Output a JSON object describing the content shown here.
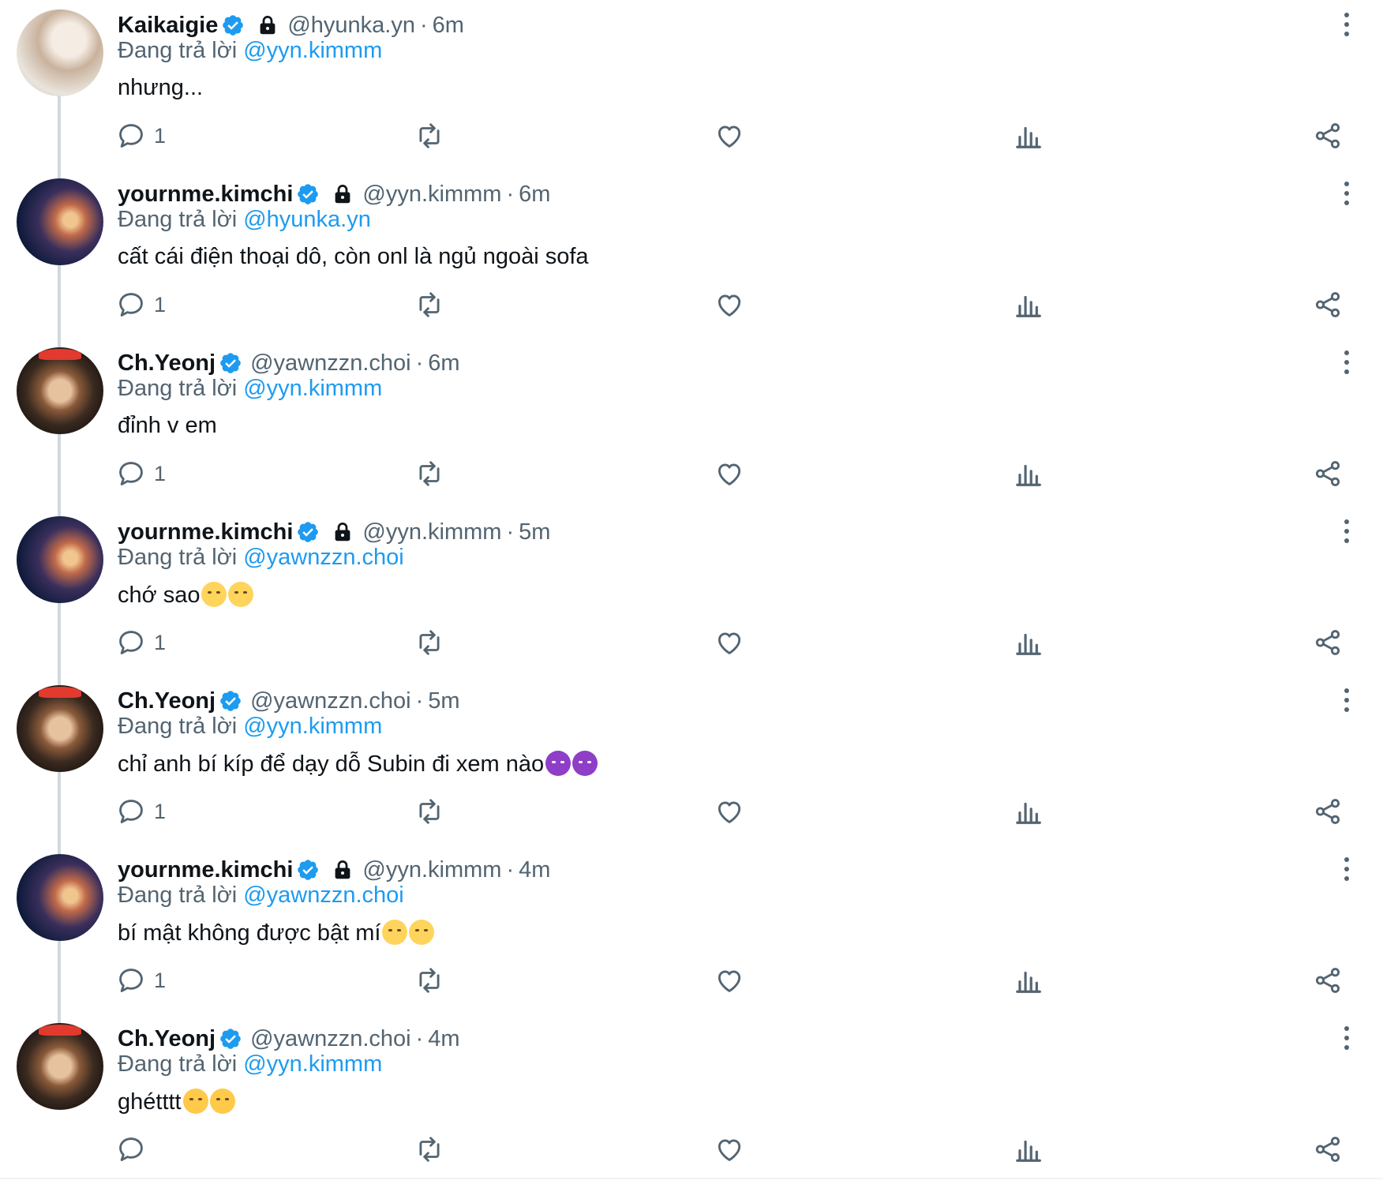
{
  "reply_prefix": "Đang trả lời",
  "colors": {
    "accent": "#1d9bf0",
    "text": "#0f1419",
    "muted": "#536471",
    "thread": "#cfd9de"
  },
  "tweets": [
    {
      "name": "Kaikaigie",
      "handle": "@hyunka.yn",
      "separator": "·",
      "time": "6m",
      "protected": true,
      "avatar": "kai",
      "reply_to": "@yyn.kimmm",
      "text": "nhưng...",
      "emojis": [],
      "reply_count": "1"
    },
    {
      "name": "yournme.kimchi",
      "handle": "@yyn.kimmm",
      "separator": "·",
      "time": "6m",
      "protected": true,
      "avatar": "kim",
      "reply_to": "@hyunka.yn",
      "text": "cất cái điện thoại dô, còn onl là ngủ ngoài sofa",
      "emojis": [],
      "reply_count": "1"
    },
    {
      "name": "Ch.Yeonj",
      "handle": "@yawnzzn.choi",
      "separator": "·",
      "time": "6m",
      "protected": false,
      "avatar": "yeon",
      "reply_to": "@yyn.kimmm",
      "text": "đỉnh v em",
      "emojis": [],
      "reply_count": "1"
    },
    {
      "name": "yournme.kimchi",
      "handle": "@yyn.kimmm",
      "separator": "·",
      "time": "5m",
      "protected": true,
      "avatar": "kim",
      "reply_to": "@yawnzzn.choi",
      "text": "chớ sao",
      "emojis": [
        "relieved-face-emoji",
        "relieved-face-emoji"
      ],
      "reply_count": "1"
    },
    {
      "name": "Ch.Yeonj",
      "handle": "@yawnzzn.choi",
      "separator": "·",
      "time": "5m",
      "protected": false,
      "avatar": "yeon",
      "reply_to": "@yyn.kimmm",
      "text": "chỉ anh bí kíp để dạy dỗ Subin đi xem nào",
      "emojis": [
        "smiling-devil-emoji",
        "smiling-devil-emoji"
      ],
      "reply_count": "1"
    },
    {
      "name": "yournme.kimchi",
      "handle": "@yyn.kimmm",
      "separator": "·",
      "time": "4m",
      "protected": true,
      "avatar": "kim",
      "reply_to": "@yawnzzn.choi",
      "text": "bí mật không được bật mí",
      "emojis": [
        "shushing-face-emoji",
        "shushing-face-emoji"
      ],
      "reply_count": "1"
    },
    {
      "name": "Ch.Yeonj",
      "handle": "@yawnzzn.choi",
      "separator": "·",
      "time": "4m",
      "protected": false,
      "avatar": "yeon",
      "reply_to": "@yyn.kimmm",
      "text": "ghétttt",
      "emojis": [
        "angry-face-emoji",
        "angry-face-emoji"
      ],
      "reply_count": ""
    }
  ],
  "icons": {
    "verified": "verified-badge-icon",
    "protected": "lock-icon",
    "more": "more-options-icon",
    "reply": "reply-icon",
    "retweet": "retweet-icon",
    "like": "heart-icon",
    "views": "views-icon",
    "share": "share-icon"
  }
}
